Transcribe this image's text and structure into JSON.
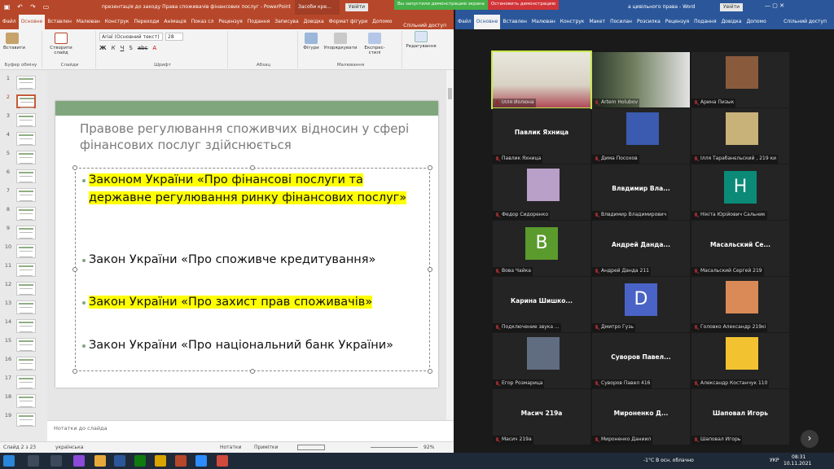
{
  "powerpoint": {
    "doc_title": "презентація до заходу Права споживачів фінансових послуг  -  PowerPoint",
    "context_tab": "Засоби кре...",
    "sign_in": "Увійти",
    "tabs": [
      "Файл",
      "Основне",
      "Вставлен",
      "Малюван",
      "Конструк",
      "Переходи",
      "Анімація",
      "Показ сл",
      "Рецензуя",
      "Подання",
      "Записува",
      "Довідка",
      "Формат фігури",
      "Допомо"
    ],
    "share": "Спільний доступ",
    "ribbon": {
      "paste": "Вставити",
      "create_slide": "Створити слайд",
      "font_name": "Arial (Основний текст)",
      "font_size": "28",
      "shapes": "Фігури",
      "arrange": "Упорядкувати",
      "express_styles": "Експрес-стилі",
      "editing": "Редагування",
      "groups": [
        "Буфер обміну",
        "Слайди",
        "Шрифт",
        "Абзац",
        "Малювання"
      ]
    },
    "thumbnails": [
      "1",
      "2",
      "3",
      "4",
      "5",
      "6",
      "7",
      "8",
      "9",
      "10",
      "11",
      "12",
      "13",
      "14",
      "15",
      "16",
      "17",
      "18",
      "19"
    ],
    "selected_slide": "2",
    "slide": {
      "title": "Правове регулювання споживчих відносин у сфері   фінансових послуг здійснюється",
      "bullets": [
        {
          "text": "Законом України «Про фінансові послуги та державне регулювання ринку фінансових послуг»",
          "highlight": true
        },
        {
          "text": "Закон України «Про споживче кредитування»",
          "highlight": false
        },
        {
          "text": "Закон України «Про захист прав споживачів»",
          "highlight": true
        },
        {
          "text": "Закон України «Про національний банк України»",
          "highlight": false
        }
      ]
    },
    "notes_placeholder": "Нотатки до слайда",
    "status": {
      "slide_info": "Слайд 2 з 23",
      "language": "українська",
      "notes": "Нотатки",
      "comments": "Примітки",
      "zoom": "92%"
    }
  },
  "word": {
    "doc_title": "а цивільного права  -  Word",
    "sign_in": "Увійти",
    "tabs": [
      "Файл",
      "Основне",
      "Вставлен",
      "Малюван",
      "Конструк",
      "Макет",
      "Посилан",
      "Розсилка",
      "Рецензуя",
      "Подання",
      "Довідка",
      "Допомо"
    ],
    "share": "Спільний доступ"
  },
  "zoom_share_bar": {
    "message": "Вы запустили демонстрацию экрана",
    "stop": "Остановить демонстрацию"
  },
  "participants": [
    {
      "display": "video",
      "name": "Ілля Иолюна",
      "active": true
    },
    {
      "display": "video",
      "name": "Artem Holubov"
    },
    {
      "display": "avatar",
      "name": "Арина Пизык"
    },
    {
      "display": "text",
      "big": "Павлик Яхница",
      "name": "Павлик Яхница"
    },
    {
      "display": "avatar",
      "name": "Дима Посохов"
    },
    {
      "display": "avatar",
      "name": "Ілля Тарабанєльский , 219 ки"
    },
    {
      "display": "avatar",
      "name": "Федор Сидоренко"
    },
    {
      "display": "text",
      "big": "Влвдимир  Вла...",
      "name": "Влвдимир Владимирович"
    },
    {
      "display": "letter",
      "letter": "Н",
      "color": "#0b8a78",
      "name": "Нікіта Юрійович Сальник"
    },
    {
      "display": "letter",
      "letter": "В",
      "color": "#5b9a2d",
      "name": "Вова Чайка"
    },
    {
      "display": "text",
      "big": "Андрей  Данда...",
      "name": "Андрей Данда 211"
    },
    {
      "display": "text",
      "big": "Масальский  Се...",
      "name": "Масальский Сергей 219"
    },
    {
      "display": "text",
      "big": "Карина  Шишко...",
      "name": "Подключение звука ..."
    },
    {
      "display": "letter",
      "letter": "D",
      "color": "#4a63c6",
      "name": "Дмитро Гузь"
    },
    {
      "display": "avatar",
      "name": "Головко Александр 219кі"
    },
    {
      "display": "avatar",
      "name": "Егор Розмарица"
    },
    {
      "display": "text",
      "big": "Суворов  Павел...",
      "name": "Суворов Павел 416"
    },
    {
      "display": "avatar",
      "name": "Александр Костанчук 110"
    },
    {
      "display": "text",
      "big": "Масич 219а",
      "name": "Масич 219а"
    },
    {
      "display": "text",
      "big": "Мироненко  Д...",
      "name": "Мироненко Даниил"
    },
    {
      "display": "text",
      "big": "Шаповал Игорь",
      "name": "Шаповал Игорь"
    }
  ],
  "taskbar": {
    "weather": "-1°C  В осн. облачно",
    "language": "УКР",
    "time": "08:31",
    "date": "10.11.2021"
  },
  "colors": {
    "ppt_accent": "#b7472a",
    "word_accent": "#2b579a",
    "slide_band": "#7fa67c",
    "highlight": "#ffff00"
  }
}
